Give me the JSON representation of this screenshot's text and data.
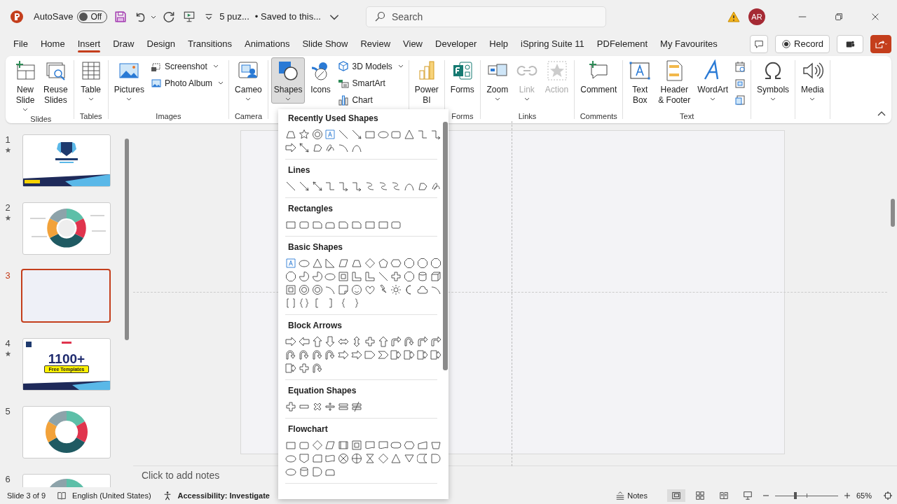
{
  "title_bar": {
    "autosave_label": "AutoSave",
    "autosave": {
      "label": "Off",
      "on": false
    },
    "document": "5 puz...",
    "save_status": "• Saved to this...",
    "search_placeholder": "Search",
    "avatar": "AR"
  },
  "menu_tabs": [
    {
      "label": "File",
      "selected": false
    },
    {
      "label": "Home",
      "selected": false
    },
    {
      "label": "Insert",
      "selected": true
    },
    {
      "label": "Draw",
      "selected": false
    },
    {
      "label": "Design",
      "selected": false
    },
    {
      "label": "Transitions",
      "selected": false
    },
    {
      "label": "Animations",
      "selected": false
    },
    {
      "label": "Slide Show",
      "selected": false
    },
    {
      "label": "Review",
      "selected": false
    },
    {
      "label": "View",
      "selected": false
    },
    {
      "label": "Developer",
      "selected": false
    },
    {
      "label": "Help",
      "selected": false
    },
    {
      "label": "iSpring Suite 11",
      "selected": false
    },
    {
      "label": "PDFelement",
      "selected": false
    },
    {
      "label": "My Favourites",
      "selected": false
    }
  ],
  "record_button": "Record",
  "ribbon_groups": [
    {
      "label": "Slides",
      "items": [
        {
          "kind": "large",
          "lines": [
            "New",
            "Slide"
          ],
          "dropdown": true,
          "disabled": false,
          "expanded": false
        },
        {
          "kind": "large",
          "lines": [
            "Reuse",
            "Slides"
          ],
          "dropdown": false,
          "disabled": false,
          "expanded": false
        }
      ]
    },
    {
      "label": "Tables",
      "items": [
        {
          "kind": "large",
          "lines": [
            "Table"
          ],
          "dropdown": true,
          "disabled": false,
          "expanded": false
        }
      ]
    },
    {
      "label": "Images",
      "items": [
        {
          "kind": "large",
          "lines": [
            "Pictures"
          ],
          "dropdown": true,
          "disabled": false,
          "expanded": false
        },
        {
          "kind": "small",
          "lines": [
            "Screenshot"
          ],
          "dropdown": true,
          "disabled": false,
          "expanded": false
        },
        {
          "kind": "small",
          "lines": [
            "Photo Album"
          ],
          "dropdown": true,
          "disabled": false,
          "expanded": false
        }
      ]
    },
    {
      "label": "Camera",
      "items": [
        {
          "kind": "large",
          "lines": [
            "Cameo"
          ],
          "dropdown": true,
          "disabled": false,
          "expanded": false
        }
      ]
    },
    {
      "items": [
        {
          "kind": "large",
          "lines": [
            "Shapes"
          ],
          "dropdown": true,
          "disabled": false,
          "expanded": true
        },
        {
          "kind": "large",
          "lines": [
            "Icons"
          ],
          "dropdown": false,
          "disabled": false,
          "expanded": false
        },
        {
          "kind": "small",
          "lines": [
            "3D Models"
          ],
          "dropdown": true,
          "disabled": false,
          "expanded": false
        },
        {
          "kind": "small",
          "lines": [
            "SmartArt"
          ],
          "dropdown": false,
          "disabled": false,
          "expanded": false
        },
        {
          "kind": "small",
          "lines": [
            "Chart"
          ],
          "dropdown": false,
          "disabled": false,
          "expanded": false
        }
      ]
    },
    {
      "items": [
        {
          "kind": "large",
          "lines": [
            "Power",
            "BI"
          ],
          "dropdown": false,
          "disabled": false,
          "expanded": false
        }
      ]
    },
    {
      "label": "Forms",
      "items": [
        {
          "kind": "large",
          "lines": [
            "Forms"
          ],
          "dropdown": false,
          "disabled": false,
          "expanded": false
        }
      ]
    },
    {
      "label": "Links",
      "items": [
        {
          "kind": "large",
          "lines": [
            "Zoom"
          ],
          "dropdown": true,
          "disabled": false,
          "expanded": false
        },
        {
          "kind": "large",
          "lines": [
            "Link"
          ],
          "dropdown": true,
          "disabled": true,
          "expanded": false
        },
        {
          "kind": "large",
          "lines": [
            "Action"
          ],
          "dropdown": false,
          "disabled": true,
          "expanded": false
        }
      ]
    },
    {
      "label": "Comments",
      "items": [
        {
          "kind": "large",
          "lines": [
            "Comment"
          ],
          "dropdown": false,
          "disabled": false,
          "expanded": false
        }
      ]
    },
    {
      "label": "Text",
      "items": [
        {
          "kind": "large",
          "lines": [
            "Text",
            "Box"
          ],
          "dropdown": false,
          "disabled": false,
          "expanded": false
        },
        {
          "kind": "large",
          "lines": [
            "Header",
            "& Footer"
          ],
          "dropdown": false,
          "disabled": false,
          "expanded": false
        },
        {
          "kind": "large",
          "lines": [
            "WordArt"
          ],
          "dropdown": true,
          "disabled": false,
          "expanded": false
        },
        {
          "kind": "small",
          "dropdown": false,
          "disabled": false,
          "expanded": false
        },
        {
          "kind": "small",
          "dropdown": false,
          "disabled": false,
          "expanded": false
        },
        {
          "kind": "small",
          "dropdown": false,
          "disabled": false,
          "expanded": false
        }
      ]
    },
    {
      "items": [
        {
          "kind": "large",
          "lines": [
            "Symbols"
          ],
          "dropdown": true,
          "disabled": false,
          "expanded": false
        }
      ]
    },
    {
      "items": [
        {
          "kind": "large",
          "lines": [
            "Media"
          ],
          "dropdown": true,
          "disabled": false,
          "expanded": false
        }
      ]
    }
  ],
  "shapes_menu": [
    {
      "title": "Recently Used Shapes",
      "shapes": [
        {
          "kind": "trapezoid"
        },
        {
          "kind": "star"
        },
        {
          "kind": "donut"
        },
        {
          "kind": "textbox"
        },
        {
          "kind": "line"
        },
        {
          "kind": "arrow"
        },
        {
          "kind": "rect"
        },
        {
          "kind": "oval"
        },
        {
          "kind": "roundrect"
        },
        {
          "kind": "triangle"
        },
        {
          "kind": "elbow"
        },
        {
          "kind": "elbowarrow"
        },
        {
          "kind": "blockright"
        },
        {
          "kind": "darrow"
        },
        {
          "kind": "freeform"
        },
        {
          "kind": "scribble"
        },
        {
          "kind": "arc"
        },
        {
          "kind": "curve"
        }
      ]
    },
    {
      "title": "Lines",
      "shapes": [
        {
          "kind": "line"
        },
        {
          "kind": "arrow"
        },
        {
          "kind": "darrow"
        },
        {
          "kind": "elbow"
        },
        {
          "kind": "elbowarrow"
        },
        {
          "kind": "elbowarrow"
        },
        {
          "kind": "curveconn"
        },
        {
          "kind": "curveconn"
        },
        {
          "kind": "curveconn"
        },
        {
          "kind": "curve"
        },
        {
          "kind": "freeform"
        },
        {
          "kind": "scribble"
        }
      ]
    },
    {
      "title": "Rectangles",
      "shapes": [
        {
          "kind": "rect"
        },
        {
          "kind": "roundrect"
        },
        {
          "kind": "snip"
        },
        {
          "kind": "roundtop"
        },
        {
          "kind": "snip"
        },
        {
          "kind": "snip"
        },
        {
          "kind": "rect"
        },
        {
          "kind": "rect"
        },
        {
          "kind": "roundrect"
        }
      ]
    },
    {
      "title": "Basic Shapes",
      "shapes": [
        {
          "kind": "textbox"
        },
        {
          "kind": "oval"
        },
        {
          "kind": "triangle"
        },
        {
          "kind": "rtriangle"
        },
        {
          "kind": "parallelogram"
        },
        {
          "kind": "trapezoid"
        },
        {
          "kind": "diamond"
        },
        {
          "kind": "pentagon"
        },
        {
          "kind": "hexagon"
        },
        {
          "kind": "octagon"
        },
        {
          "kind": "octagon"
        },
        {
          "kind": "octagon"
        },
        {
          "kind": "octagon"
        },
        {
          "kind": "pie"
        },
        {
          "kind": "pie"
        },
        {
          "kind": "oval"
        },
        {
          "kind": "frame"
        },
        {
          "kind": "lshape"
        },
        {
          "kind": "lshape"
        },
        {
          "kind": "line"
        },
        {
          "kind": "cross"
        },
        {
          "kind": "octagon"
        },
        {
          "kind": "cylinder"
        },
        {
          "kind": "cube"
        },
        {
          "kind": "frame"
        },
        {
          "kind": "donut"
        },
        {
          "kind": "donut"
        },
        {
          "kind": "arc"
        },
        {
          "kind": "fold"
        },
        {
          "kind": "smiley"
        },
        {
          "kind": "heart"
        },
        {
          "kind": "bolt"
        },
        {
          "kind": "sun"
        },
        {
          "kind": "moon"
        },
        {
          "kind": "cloud"
        },
        {
          "kind": "arc"
        },
        {
          "kind": "bracketpair"
        },
        {
          "kind": "bracepair"
        },
        {
          "kind": "lbracket"
        },
        {
          "kind": "rbracket"
        },
        {
          "kind": "lbrace"
        },
        {
          "kind": "rbrace"
        }
      ]
    },
    {
      "title": "Block Arrows",
      "shapes": [
        {
          "kind": "blockright"
        },
        {
          "kind": "blockleft"
        },
        {
          "kind": "blockup"
        },
        {
          "kind": "blockdown"
        },
        {
          "kind": "blockh"
        },
        {
          "kind": "blockv"
        },
        {
          "kind": "cross"
        },
        {
          "kind": "blockup"
        },
        {
          "kind": "bent"
        },
        {
          "kind": "uturn"
        },
        {
          "kind": "bent"
        },
        {
          "kind": "bent"
        },
        {
          "kind": "uturn"
        },
        {
          "kind": "uturn"
        },
        {
          "kind": "uturn"
        },
        {
          "kind": "uturn"
        },
        {
          "kind": "notched"
        },
        {
          "kind": "notched"
        },
        {
          "kind": "pentarrow"
        },
        {
          "kind": "chevron"
        },
        {
          "kind": "callout"
        },
        {
          "kind": "callout"
        },
        {
          "kind": "callout"
        },
        {
          "kind": "callout"
        },
        {
          "kind": "callout"
        },
        {
          "kind": "cross"
        },
        {
          "kind": "uturn"
        }
      ]
    },
    {
      "title": "Equation Shapes",
      "shapes": [
        {
          "kind": "plus"
        },
        {
          "kind": "minus"
        },
        {
          "kind": "multiply"
        },
        {
          "kind": "divide"
        },
        {
          "kind": "equal"
        },
        {
          "kind": "notequal"
        }
      ]
    },
    {
      "title": "Flowchart",
      "shapes": [
        {
          "kind": "rect"
        },
        {
          "kind": "roundrect"
        },
        {
          "kind": "diamond"
        },
        {
          "kind": "parallelogram"
        },
        {
          "kind": "predef"
        },
        {
          "kind": "frame"
        },
        {
          "kind": "doc"
        },
        {
          "kind": "doc"
        },
        {
          "kind": "terminator"
        },
        {
          "kind": "hexagon"
        },
        {
          "kind": "manualinput"
        },
        {
          "kind": "manual"
        },
        {
          "kind": "oval"
        },
        {
          "kind": "offpage"
        },
        {
          "kind": "card"
        },
        {
          "kind": "tape"
        },
        {
          "kind": "xor"
        },
        {
          "kind": "or"
        },
        {
          "kind": "hourglass"
        },
        {
          "kind": "diamond"
        },
        {
          "kind": "triangle"
        },
        {
          "kind": "merge"
        },
        {
          "kind": "stored"
        },
        {
          "kind": "delay"
        },
        {
          "kind": "oval"
        },
        {
          "kind": "cylinder"
        },
        {
          "kind": "delay"
        },
        {
          "kind": "roundtop"
        }
      ]
    }
  ],
  "slides": [
    {
      "number": "1",
      "kind": "title",
      "starred": true,
      "selected": false
    },
    {
      "number": "2",
      "kind": "puzzle",
      "starred": true,
      "selected": false
    },
    {
      "number": "3",
      "kind": "blank",
      "starred": false,
      "selected": true
    },
    {
      "number": "4",
      "kind": "promo",
      "starred": true,
      "selected": false,
      "headline": "1100+",
      "badge": "Free Templates"
    },
    {
      "number": "5",
      "kind": "ring",
      "starred": false,
      "selected": false
    },
    {
      "number": "6",
      "kind": "ring",
      "starred": false,
      "selected": false
    }
  ],
  "notes_placeholder": "Click to add notes",
  "status_bar": {
    "slide_info": "Slide 3 of 9",
    "language": "English (United States)",
    "accessibility": "Accessibility: Investigate",
    "notes_button": "Notes",
    "zoom": {
      "level": 0.32,
      "reading": "65%"
    }
  }
}
